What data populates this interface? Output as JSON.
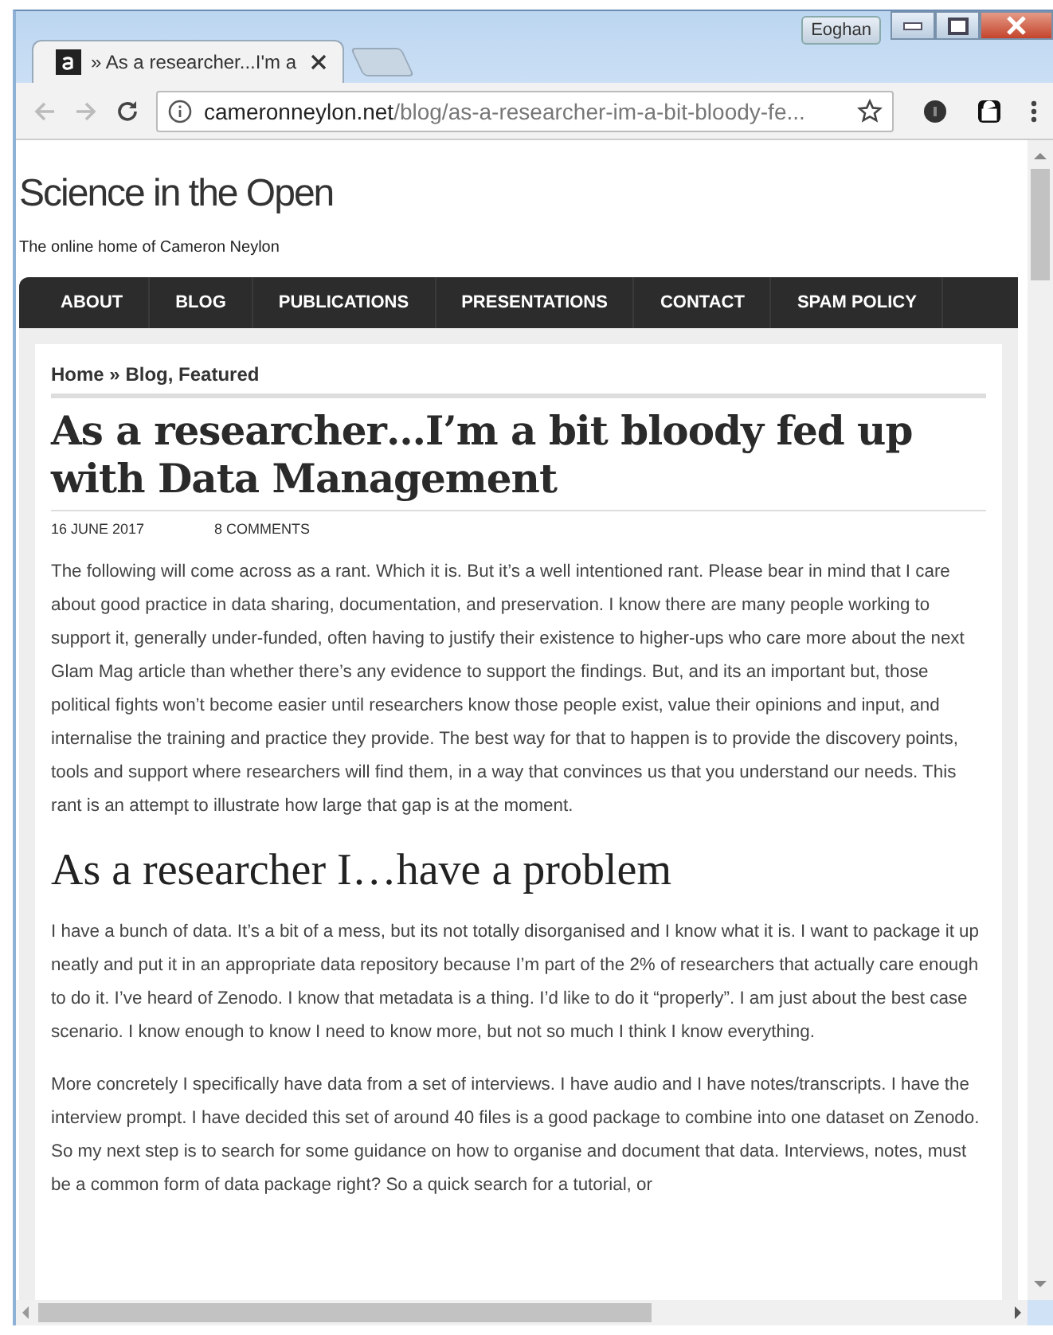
{
  "window": {
    "user": "Eoghan"
  },
  "tabs": [
    {
      "title": "» As a researcher...I'm a",
      "selected": true
    }
  ],
  "address_bar": {
    "domain": "cameronneylon.net",
    "path": "/blog/as-a-researcher-im-a-bit-bloody-fe..."
  },
  "site": {
    "title": "Science in the Open",
    "tagline": "The online home of Cameron Neylon"
  },
  "nav": [
    "ABOUT",
    "BLOG",
    "PUBLICATIONS",
    "PRESENTATIONS",
    "CONTACT",
    "SPAM POLICY"
  ],
  "breadcrumb": "**Home** » **Blog, Featured**",
  "post": {
    "title": "As a researcher…I’m a bit bloody fed up with Data Management",
    "date": "16 JUNE 2017",
    "comments": "8 COMMENTS",
    "blocks": [
      {
        "kind": "paragraph",
        "text": "The following will come across as a rant. Which it is. But it’s a well intentioned rant. Please bear in mind that I care about good practice in data sharing, documentation, and preservation. I know there are many people working to support it, generally under-funded, often having to justify their existence to higher-ups who care more about the next Glam Mag article than whether there’s any evidence to support the findings. But, and its an important but, those political fights won’t become easier until researchers know those people exist, value their opinions and input, and internalise the training and practice they provide. The best way for that to happen is to provide the discovery points, tools and support where researchers will find them, in a way that convinces us that you understand our needs. This rant is an attempt to illustrate how large that gap is at the moment."
      },
      {
        "kind": "heading",
        "text": "As a researcher I…have a problem"
      },
      {
        "kind": "paragraph",
        "text": "I have a bunch of data. It’s a bit of a mess, but its not totally disorganised and I know what it is. I want to package it up neatly and put it in an appropriate data repository because I’m part of the 2% of researchers that actually care enough to do it. I’ve heard of Zenodo. I know that metadata is a thing. I’d like to do it “properly”. I am just about the best case scenario. I know enough to know I need to know more, but not so much I think I know everything."
      },
      {
        "kind": "paragraph",
        "text": "More concretely I specifically have data from a set of interviews. I have audio and I have notes/transcripts. I have the interview prompt. I have decided this set of around 40 files is a good package to combine into one dataset on Zenodo. So my next step is to search for some guidance on how to organise and document that data. Interviews, notes, must be a common form of data package right? So a quick search for a tutorial, or"
      }
    ]
  }
}
